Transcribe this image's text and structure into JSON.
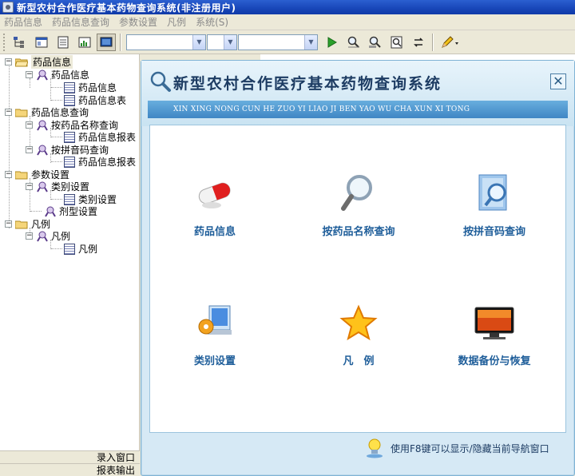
{
  "window": {
    "title": "新型农村合作医疗基本药物查询系统(非注册用户)"
  },
  "menubar": {
    "items": [
      "药品信息",
      "药品信息查询",
      "参数设置",
      "凡例",
      "系统(S)"
    ]
  },
  "toolbar": {
    "icons": [
      "tree-toggle-icon",
      "window-icon",
      "document-icon",
      "chart-icon",
      "monitor-icon",
      "play-icon",
      "find-icon",
      "find-next-icon",
      "zoom-icon",
      "refresh-icon",
      "pencil-icon"
    ],
    "combos": [
      "",
      "",
      ""
    ]
  },
  "tree": {
    "nodes": [
      {
        "label": "药品信息"
      },
      {
        "label": "药品信息"
      },
      {
        "label": "药品信息"
      },
      {
        "label": "药品信息表"
      },
      {
        "label": "药品信息查询"
      },
      {
        "label": "按药品名称查询"
      },
      {
        "label": "药品信息报表"
      },
      {
        "label": "按拼音码查询"
      },
      {
        "label": "药品信息报表"
      },
      {
        "label": "参数设置"
      },
      {
        "label": "类别设置"
      },
      {
        "label": "类别设置"
      },
      {
        "label": "剂型设置"
      },
      {
        "label": "凡例"
      },
      {
        "label": "凡例"
      },
      {
        "label": "凡例"
      }
    ]
  },
  "status": {
    "line1": "录入窗口",
    "line2": "报表输出"
  },
  "dialog": {
    "title": "新型农村合作医疗基本药物查询系统",
    "subtitle": "XIN XING NONG CUN HE ZUO YI LIAO JI BEN YAO WU CHA XUN XI TONG",
    "close": "✕",
    "tiles": [
      {
        "label": "药品信息",
        "icon": "pill-icon"
      },
      {
        "label": "按药品名称查询",
        "icon": "magnifier-icon"
      },
      {
        "label": "按拼音码查询",
        "icon": "document-search-icon"
      },
      {
        "label": "类别设置",
        "icon": "settings-monitor-icon"
      },
      {
        "label": "凡　例",
        "icon": "star-icon"
      },
      {
        "label": "数据备份与恢复",
        "icon": "display-icon"
      }
    ],
    "footer_tip": "使用F8键可以显示/隐藏当前导航窗口"
  }
}
